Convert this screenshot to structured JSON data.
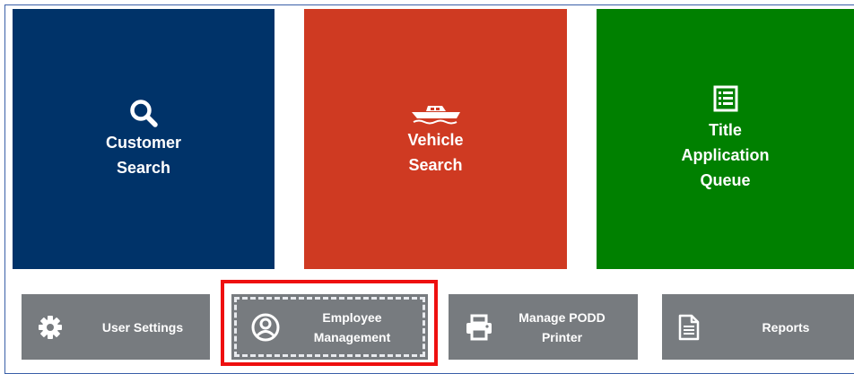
{
  "tiles": {
    "customer_search": {
      "line1": "Customer",
      "line2": "Search",
      "icon": "search-icon",
      "color": "#003369"
    },
    "vehicle_search": {
      "line1": "Vehicle",
      "line2": "Search",
      "icon": "boat-icon",
      "color": "#cf3a22"
    },
    "title_queue": {
      "line1": "Title",
      "line2": "Application",
      "line3": "Queue",
      "icon": "list-icon",
      "color": "#008000"
    }
  },
  "buttons": {
    "user_settings": {
      "label": "User Settings",
      "icon": "gear-icon"
    },
    "employee_management": {
      "line1": "Employee",
      "line2": "Management",
      "icon": "user-circle-icon",
      "highlighted": true
    },
    "manage_podd_printer": {
      "line1": "Manage PODD",
      "line2": "Printer",
      "icon": "printer-icon"
    },
    "reports": {
      "label": "Reports",
      "icon": "document-icon"
    }
  },
  "colors": {
    "button_gray": "#777b7f",
    "highlight_red": "#ee0f0f"
  }
}
